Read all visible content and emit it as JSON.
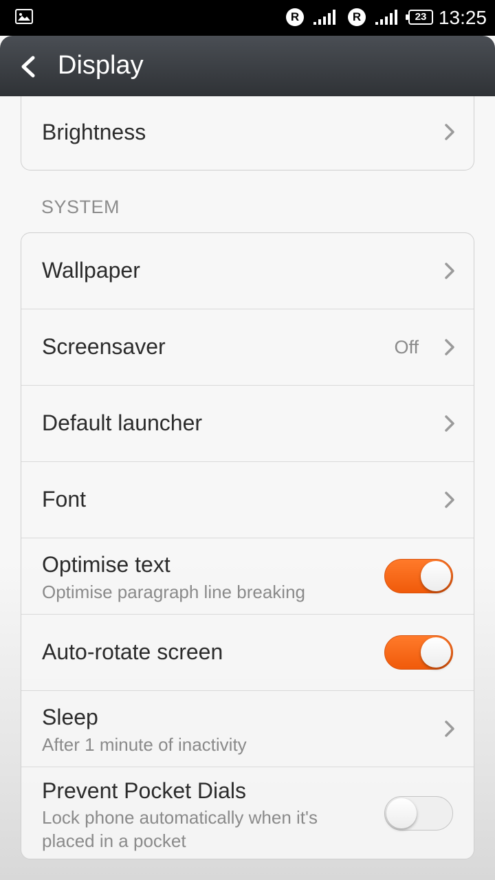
{
  "status_bar": {
    "battery": "23",
    "time": "13:25",
    "roaming_label": "R"
  },
  "header": {
    "title": "Display"
  },
  "top_group": {
    "items": [
      {
        "label": "Brightness"
      }
    ]
  },
  "system_section": {
    "header": "SYSTEM",
    "items": [
      {
        "label": "Wallpaper"
      },
      {
        "label": "Screensaver",
        "value": "Off"
      },
      {
        "label": "Default launcher"
      },
      {
        "label": "Font"
      },
      {
        "label": "Optimise text",
        "subtitle": "Optimise paragraph line breaking",
        "toggle": true
      },
      {
        "label": "Auto-rotate screen",
        "toggle": true
      },
      {
        "label": "Sleep",
        "subtitle": "After 1 minute of inactivity"
      },
      {
        "label": "Prevent Pocket Dials",
        "subtitle": "Lock phone automatically when it's placed in a pocket",
        "toggle": false
      }
    ]
  },
  "colors": {
    "accent": "#f26416",
    "title_bar": "#3a3d42"
  }
}
